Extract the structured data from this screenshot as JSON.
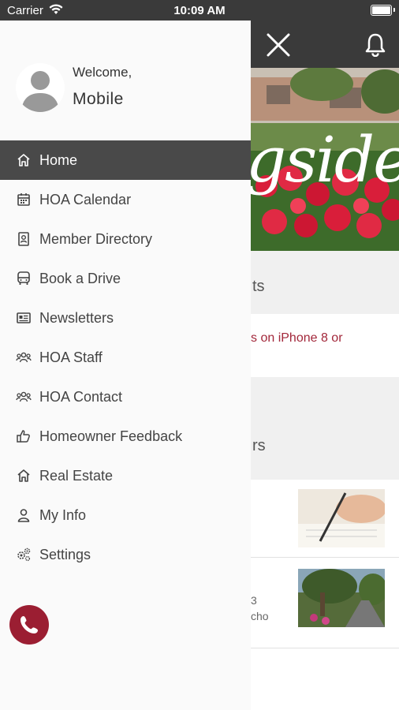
{
  "status_bar": {
    "carrier": "Carrier",
    "time": "10:09 AM"
  },
  "drawer": {
    "welcome": "Welcome,",
    "username": "Mobile",
    "menu": [
      {
        "label": "Home",
        "icon": "home-icon"
      },
      {
        "label": "HOA Calendar",
        "icon": "calendar-icon"
      },
      {
        "label": "Member Directory",
        "icon": "contacts-icon"
      },
      {
        "label": "Book a Drive",
        "icon": "bus-icon"
      },
      {
        "label": "Newsletters",
        "icon": "newspaper-icon"
      },
      {
        "label": "HOA Staff",
        "icon": "group-icon"
      },
      {
        "label": "HOA Contact",
        "icon": "group-icon"
      },
      {
        "label": "Homeowner Feedback",
        "icon": "thumbs-up-icon"
      },
      {
        "label": "Real Estate",
        "icon": "home-icon"
      },
      {
        "label": "My Info",
        "icon": "user-icon"
      },
      {
        "label": "Settings",
        "icon": "gears-icon"
      }
    ],
    "active_index": 0
  },
  "background": {
    "hero_text": "gside",
    "section1_text": "ts",
    "notice_text": "s on iPhone 8 or",
    "section2_text": "rs",
    "news2_line1": "3",
    "news2_line2": "cho"
  },
  "colors": {
    "accent": "#9b1e32",
    "header": "#3a3a3a",
    "active_item": "#494949"
  }
}
